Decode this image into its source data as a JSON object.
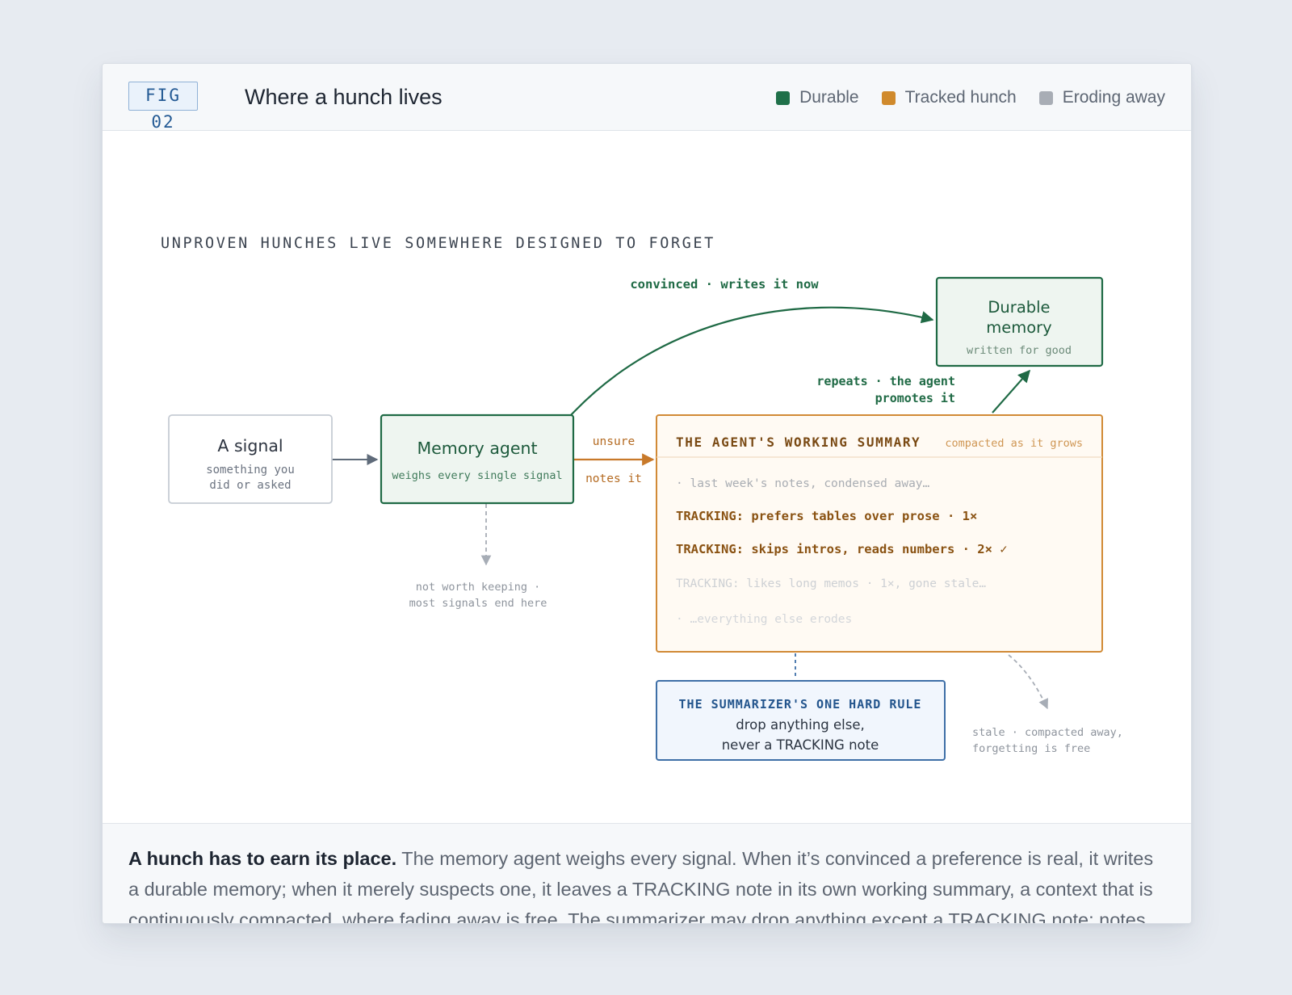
{
  "figure": {
    "tag": "FIG 02",
    "title": "Where a hunch lives"
  },
  "legend": [
    {
      "label": "Durable",
      "color": "#1f7049"
    },
    {
      "label": "Tracked hunch",
      "color": "#d08a2c"
    },
    {
      "label": "Eroding away",
      "color": "#a8adb5"
    }
  ],
  "diagram": {
    "heading": "UNPROVEN HUNCHES LIVE SOMEWHERE DESIGNED TO FORGET",
    "signal": {
      "title": "A signal",
      "sub_1": "something you",
      "sub_2": "did or asked"
    },
    "agent": {
      "title": "Memory agent",
      "sub": "weighs every single signal"
    },
    "durable": {
      "title_1": "Durable",
      "title_2": "memory",
      "sub": "written for good"
    },
    "convinced_label": "convinced · writes it now",
    "promote_label_1": "repeats · the agent",
    "promote_label_2": "promotes it",
    "unsure_label": "unsure",
    "notes_label": "notes it",
    "discard_label_1": "not worth keeping ·",
    "discard_label_2": "most signals end here",
    "summary": {
      "title": "THE AGENT'S WORKING SUMMARY",
      "note": "compacted as it grows",
      "line_1": "· last week's notes, condensed away…",
      "line_2": "TRACKING: prefers tables over prose · 1×",
      "line_3": "TRACKING: skips intros, reads numbers · 2× ✓",
      "line_4": "TRACKING: likes long memos · 1×, gone stale…",
      "line_5": "· …everything else erodes"
    },
    "rule": {
      "title": "THE SUMMARIZER'S ONE HARD RULE",
      "line_1": "drop anything else,",
      "line_2": "never a TRACKING note"
    },
    "stale_label_1": "stale · compacted away,",
    "stale_label_2": "forgetting is free"
  },
  "caption": {
    "lead": "A hunch has to earn its place.",
    "body": " The memory agent weighs every signal. When it’s convinced a preference is real, it writes a durable memory; when it merely suspects one, it leaves a TRACKING note in its own working summary, a context that is continuously compacted, where fading away is free. The summarizer may drop anything except a TRACKING note; notes that keep proving out get promoted, and stale ones simply fade."
  }
}
